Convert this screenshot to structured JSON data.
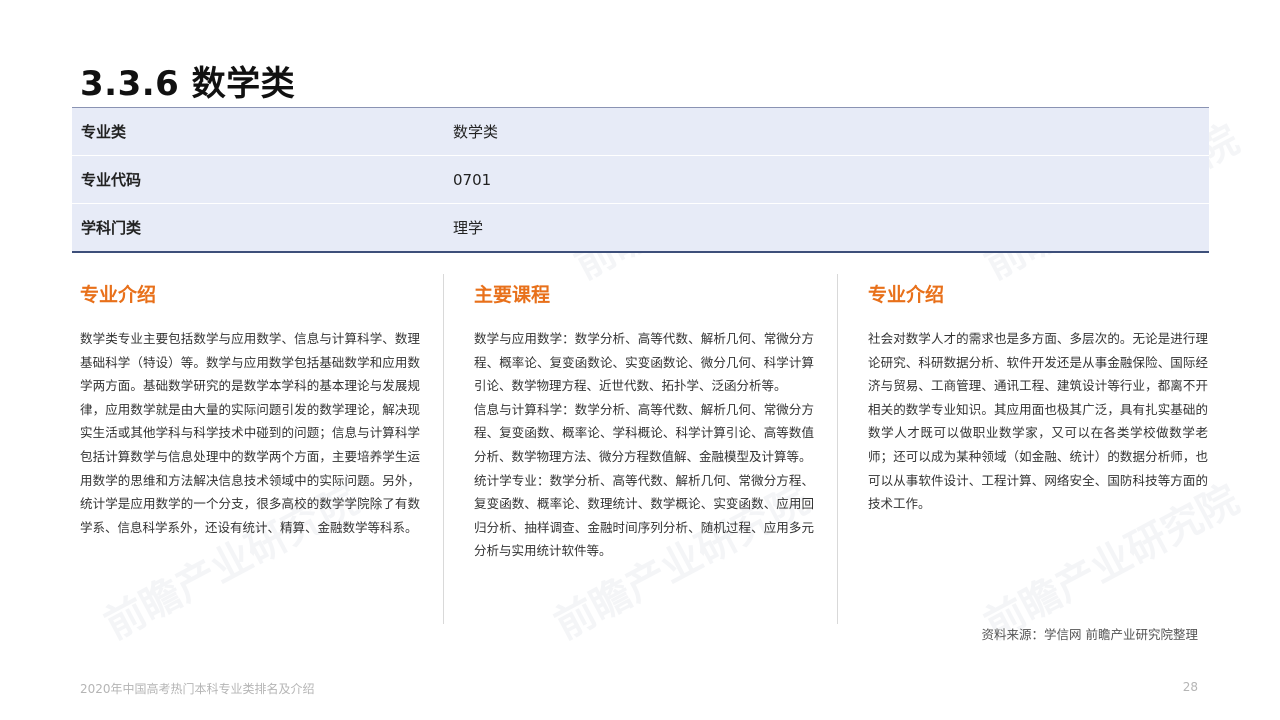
{
  "page_title": "3.3.6 数学类",
  "watermark_text": "前瞻产业研究院",
  "info_table": [
    {
      "key": "专业类",
      "value": "数学类"
    },
    {
      "key": "专业代码",
      "value": "0701"
    },
    {
      "key": "学科门类",
      "value": "理学"
    }
  ],
  "columns": [
    {
      "title": "专业介绍",
      "paragraphs": [
        "数学类专业主要包括数学与应用数学、信息与计算科学、数理基础科学（特设）等。数学与应用数学包括基础数学和应用数学两方面。基础数学研究的是数学本学科的基本理论与发展规律，应用数学就是由大量的实际问题引发的数学理论，解决现实生活或其他学科与科学技术中碰到的问题；信息与计算科学包括计算数学与信息处理中的数学两个方面，主要培养学生运用数学的思维和方法解决信息技术领域中的实际问题。另外，统计学是应用数学的一个分支，很多高校的数学学院除了有数学系、信息科学系外，还设有统计、精算、金融数学等科系。"
      ]
    },
    {
      "title": "主要课程",
      "paragraphs": [
        "数学与应用数学：数学分析、高等代数、解析几何、常微分方程、概率论、复变函数论、实变函数论、微分几何、科学计算引论、数学物理方程、近世代数、拓扑学、泛函分析等。",
        "信息与计算科学：数学分析、高等代数、解析几何、常微分方程、复变函数、概率论、学科概论、科学计算引论、高等数值分析、数学物理方法、微分方程数值解、金融模型及计算等。",
        "统计学专业：数学分析、高等代数、解析几何、常微分方程、复变函数、概率论、数理统计、数学概论、实变函数、应用回归分析、抽样调查、金融时间序列分析、随机过程、应用多元分析与实用统计软件等。"
      ]
    },
    {
      "title": "专业介绍",
      "paragraphs": [
        "社会对数学人才的需求也是多方面、多层次的。无论是进行理论研究、科研数据分析、软件开发还是从事金融保险、国际经济与贸易、工商管理、通讯工程、建筑设计等行业，都离不开相关的数学专业知识。其应用面也极其广泛，具有扎实基础的数学人才既可以做职业数学家，又可以在各类学校做数学老师；还可以成为某种领域（如金融、统计）的数据分析师，也可以从事软件设计、工程计算、网络安全、国防科技等方面的技术工作。"
      ]
    }
  ],
  "source": "资料来源：学信网 前瞻产业研究院整理",
  "footer": {
    "left": "2020年中国高考热门本科专业类排名及介绍",
    "page_number": "28"
  },
  "colors": {
    "accent": "#e8701a",
    "table_bg": "#e7ebf7",
    "table_border": "#3d4f7a"
  }
}
